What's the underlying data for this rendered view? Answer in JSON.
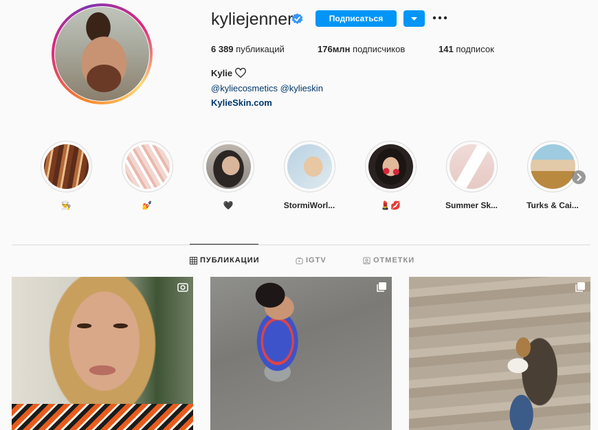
{
  "profile": {
    "username": "kyliejenner",
    "follow_label": "Подписаться",
    "posts_count": "6 389",
    "posts_label": "публикаций",
    "followers_count": "176млн",
    "followers_label": "подписчиков",
    "following_count": "141",
    "following_label": "подписок",
    "name": "Kylie",
    "bio_tags": "@kyliecosmetics @kylieskin",
    "website": "KylieSkin.com"
  },
  "highlights": [
    {
      "label": "👨‍🍳"
    },
    {
      "label": "💅"
    },
    {
      "label": "🖤"
    },
    {
      "label": "StormiWorl..."
    },
    {
      "label": "💄💋"
    },
    {
      "label": "Summer Sk..."
    },
    {
      "label": "Turks & Cai..."
    }
  ],
  "tabs": [
    {
      "label": "ПУБЛИКАЦИИ",
      "icon": "grid-icon"
    },
    {
      "label": "IGTV",
      "icon": "igtv-icon"
    },
    {
      "label": "ОТМЕТКИ",
      "icon": "tagged-icon"
    }
  ],
  "colors": {
    "accent": "#0095f6",
    "link": "#00376b",
    "verified": "#3897f0",
    "text": "#262626",
    "border": "#dbdbdb"
  },
  "posts": [
    {
      "badge": "video-icon"
    },
    {
      "badge": "carousel-icon"
    },
    {
      "badge": "carousel-icon"
    }
  ]
}
